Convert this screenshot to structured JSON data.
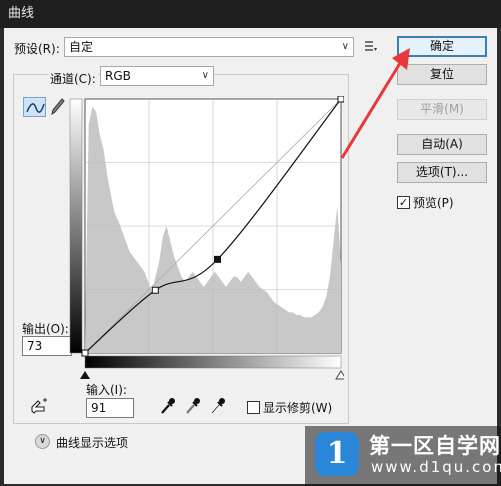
{
  "window": {
    "title": "曲线"
  },
  "preset": {
    "label": "预设(R):",
    "value": "自定"
  },
  "channel": {
    "label": "通道(C):",
    "value": "RGB"
  },
  "output": {
    "label": "输出(O):",
    "value": "73"
  },
  "input": {
    "label": "输入(I):",
    "value": "91"
  },
  "buttons": {
    "ok": "确定",
    "reset": "复位",
    "smooth": "平滑(M)",
    "auto": "自动(A)",
    "options": "选项(T)..."
  },
  "preview": {
    "label": "预览(P)",
    "checked": true
  },
  "show_clipping": {
    "label": "显示修剪(W)",
    "checked": false
  },
  "curve_display_options": "曲线显示选项",
  "curve": {
    "points": [
      [
        0,
        0
      ],
      [
        70,
        63
      ],
      [
        132,
        94
      ],
      [
        255,
        255
      ]
    ],
    "selected_point_index": 2
  },
  "watermark": {
    "title": "第一区自学网",
    "url": "www.d1qu.com",
    "logo_letter": "1"
  },
  "colors": {
    "accent": "#3c7fb1",
    "arrow": "#e8383b",
    "histogram": "#c8c8c8",
    "watermark_logo": "#2a86d8"
  },
  "icons": [
    "curve-tool-icon",
    "pencil-icon",
    "preset-options-icon",
    "targeted-adjust-icon",
    "black-eyedropper-icon",
    "gray-eyedropper-icon",
    "white-eyedropper-icon",
    "chevron-down-icon"
  ]
}
